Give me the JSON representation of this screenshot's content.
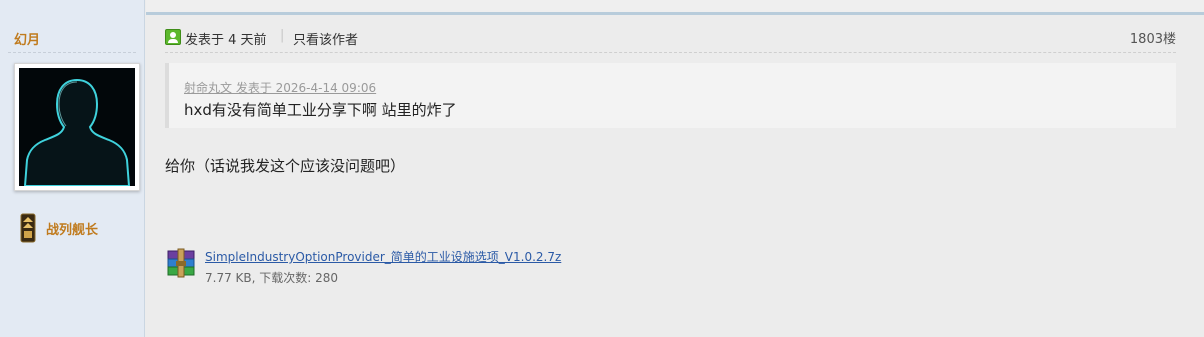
{
  "author": {
    "name": "幻月",
    "rank": "战列舰长"
  },
  "post": {
    "time_text": "发表于 4 天前",
    "divider": "|",
    "only_author_label": "只看该作者",
    "floor": "1803楼",
    "quote": {
      "meta": "射命丸文 发表于 2026-4-14 09:06",
      "text": "hxd有没有简单工业分享下啊  站里的炸了"
    },
    "body": "给你（话说我发这个应该没问题吧）",
    "attachment": {
      "icon": "winrar-archive-icon",
      "filename": "SimpleIndustryOptionProvider_简单的工业设施选项_V1.0.2.7z",
      "info": "7.77 KB, 下载次数: 280"
    }
  },
  "colors": {
    "author_name": "#c07b1e",
    "link": "#2b5aa6",
    "sidebar_bg": "#e3eaf3",
    "post_bg": "#ececec",
    "online_icon": "#5cb82d"
  }
}
